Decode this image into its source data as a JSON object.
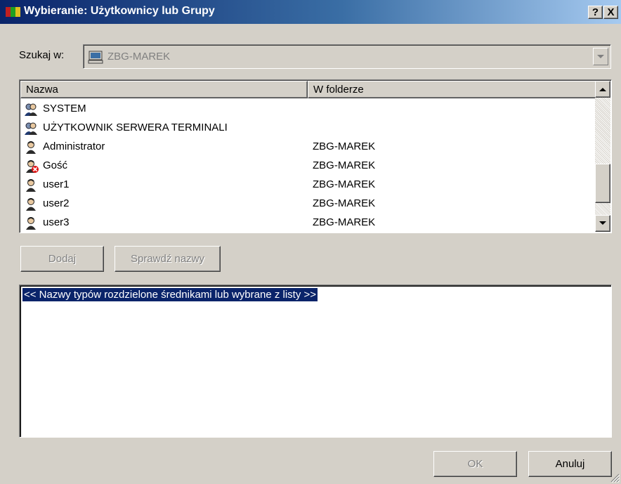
{
  "window": {
    "title": "Wybieranie: Użytkownicy lub Grupy",
    "help_label": "?",
    "close_label": "X"
  },
  "search": {
    "label": "Szukaj w:",
    "value": "ZBG-MAREK",
    "icon": "computer-icon"
  },
  "list": {
    "columns": [
      "Nazwa",
      "W folderze"
    ],
    "rows": [
      {
        "name": "SYSTEM",
        "folder": "",
        "icon": "group-icon"
      },
      {
        "name": "UŻYTKOWNIK SERWERA TERMINALI",
        "folder": "",
        "icon": "group-icon"
      },
      {
        "name": "Administrator",
        "folder": "ZBG-MAREK",
        "icon": "user-icon"
      },
      {
        "name": "Gość",
        "folder": "ZBG-MAREK",
        "icon": "disabled-user-icon"
      },
      {
        "name": "user1",
        "folder": "ZBG-MAREK",
        "icon": "user-icon"
      },
      {
        "name": "user2",
        "folder": "ZBG-MAREK",
        "icon": "user-icon"
      },
      {
        "name": "user3",
        "folder": "ZBG-MAREK",
        "icon": "user-icon"
      }
    ]
  },
  "actions": {
    "add_label": "Dodaj",
    "check_label": "Sprawdź nazwy"
  },
  "names": {
    "placeholder": "<< Nazwy typów rozdzielone średnikami lub wybrane z listy >>"
  },
  "footer": {
    "ok_label": "OK",
    "cancel_label": "Anuluj"
  },
  "colors": {
    "title_start": "#0a246a",
    "title_end": "#a6caf0",
    "face": "#d4d0c8",
    "selection": "#0a246a"
  }
}
